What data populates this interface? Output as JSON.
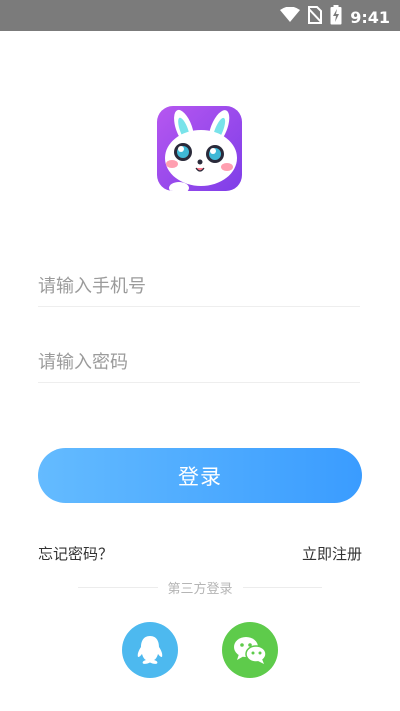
{
  "status_bar": {
    "time": "9:41",
    "icons": [
      "wifi-icon",
      "no-sim-icon",
      "battery-charging-icon"
    ]
  },
  "app": {
    "logo_icon": "bunny-mascot-logo",
    "logo_gradient": [
      "#b657f0",
      "#7e3ee8"
    ]
  },
  "form": {
    "phone_placeholder": "请输入手机号",
    "password_placeholder": "请输入密码",
    "login_label": "登录"
  },
  "links": {
    "forgot_password": "忘记密码？",
    "register": "立即注册"
  },
  "third_party": {
    "label": "第三方登录",
    "providers": [
      {
        "name": "qq-icon",
        "color": "#4db9ef"
      },
      {
        "name": "wechat-icon",
        "color": "#5ecb4b"
      }
    ]
  },
  "colors": {
    "accent_start": "#64bbff",
    "accent_end": "#3a9cff",
    "status_bar": "#7b7b7b"
  }
}
